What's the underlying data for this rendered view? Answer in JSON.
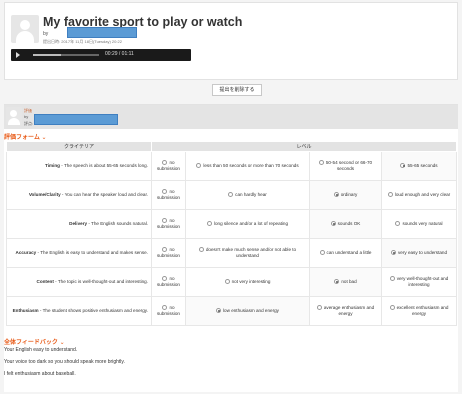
{
  "submission": {
    "title": "My favorite sport to play or watch",
    "by": "by",
    "date": "提出日時: 2017年 11月 18日(Tuesday) 20:22",
    "player": {
      "time": "00:29 / 01:11",
      "progress": 0.42
    },
    "delete_label": "提出を削除する"
  },
  "grader": {
    "role": "評価",
    "by": "by",
    "score": "評点: 32 / 50"
  },
  "rubric": {
    "section_label": "評価フォーム",
    "header_criteria": "クライテリア",
    "header_levels": "レベル",
    "rows": [
      {
        "criterion": "Timing",
        "desc": " - The speech is about 55-65 seconds long.",
        "levels": [
          {
            "label": "no submission",
            "selected": false
          },
          {
            "label": "less than 50 seconds or more than 70 seconds",
            "selected": false
          },
          {
            "label": "50-54 second or 66-70 seconds",
            "selected": false
          },
          {
            "label": "55-65 seconds",
            "selected": true
          }
        ]
      },
      {
        "criterion": "Volume/Clarity",
        "desc": " - You can hear the speaker loud and clear.",
        "levels": [
          {
            "label": "no submission",
            "selected": false
          },
          {
            "label": "can hardly hear",
            "selected": false
          },
          {
            "label": "ordinary",
            "selected": true
          },
          {
            "label": "loud enough and very clear",
            "selected": false
          }
        ]
      },
      {
        "criterion": "Delivery",
        "desc": " - The English sounds natural.",
        "levels": [
          {
            "label": "no submission",
            "selected": false
          },
          {
            "label": "long silence and/or a lot of repeating",
            "selected": false
          },
          {
            "label": "sounds OK",
            "selected": true
          },
          {
            "label": "sounds very natural",
            "selected": false
          }
        ]
      },
      {
        "criterion": "Accuracy",
        "desc": " - The English is easy to understand and makes sense.",
        "levels": [
          {
            "label": "no submission",
            "selected": false
          },
          {
            "label": "doesn't make much sense and/or not able to understand",
            "selected": false
          },
          {
            "label": "can understand a little",
            "selected": false
          },
          {
            "label": "very easy to understand",
            "selected": true
          }
        ]
      },
      {
        "criterion": "Content",
        "desc": " - The topic is well-thought-out and interesting.",
        "levels": [
          {
            "label": "no submission",
            "selected": false
          },
          {
            "label": "not very interesting",
            "selected": false
          },
          {
            "label": "not bad",
            "selected": true
          },
          {
            "label": "very well-thought-out and interesting",
            "selected": false
          }
        ]
      },
      {
        "criterion": "Enthusiasm",
        "desc": " - The student shows positive enthusiasm and energy.",
        "levels": [
          {
            "label": "no submission",
            "selected": false
          },
          {
            "label": "low enthusiasm and energy",
            "selected": true
          },
          {
            "label": "average enthusiasm and energy",
            "selected": false
          },
          {
            "label": "excellent enthusiasm and energy",
            "selected": false
          }
        ]
      }
    ]
  },
  "feedback": {
    "section_label": "全体フィードバック",
    "lines": [
      "Your English easy to understand.",
      "Your voice too dark so you should speak more brightly.",
      "I felt enthusiasm about baseball."
    ]
  },
  "colors": {
    "accent": "#e85b18",
    "redaction": "#5b9bd5",
    "player_bg": "#1a1a1a"
  },
  "icons": {
    "play": "play-icon",
    "avatar": "user-avatar-icon",
    "section_toggle": "chevron-down-icon"
  }
}
